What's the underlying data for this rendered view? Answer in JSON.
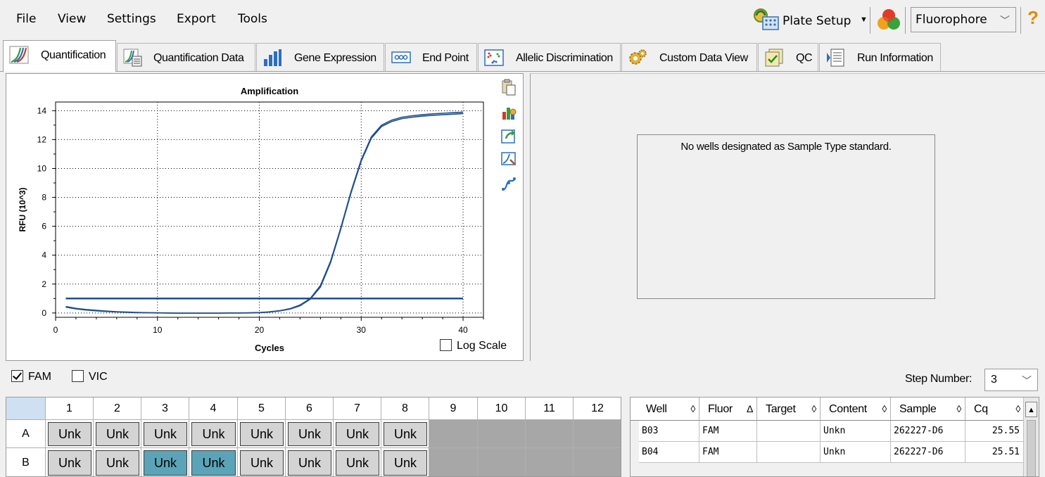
{
  "menu": [
    "File",
    "View",
    "Settings",
    "Export",
    "Tools"
  ],
  "toolbar": {
    "plate_setup_label": "Plate Setup",
    "fluorophore_select": "Fluorophore",
    "help": "?"
  },
  "tabs": [
    {
      "label": "Quantification",
      "icon": "amplification-tab-icon",
      "active": true
    },
    {
      "label": "Quantification Data",
      "icon": "quant-data-tab-icon",
      "active": false
    },
    {
      "label": "Gene Expression",
      "icon": "bar-chart-icon",
      "active": false
    },
    {
      "label": "End Point",
      "icon": "dots-icon",
      "active": false
    },
    {
      "label": "Allelic Discrimination",
      "icon": "scatter-icon",
      "active": false
    },
    {
      "label": "Custom Data View",
      "icon": "gears-icon",
      "active": false
    },
    {
      "label": "QC",
      "icon": "qc-check-icon",
      "active": false
    },
    {
      "label": "Run Information",
      "icon": "document-icon",
      "active": false
    }
  ],
  "chart_tools": [
    "copy-icon",
    "chart-settings-icon",
    "export-chart-icon",
    "zoom-chart-icon",
    "curve-icon"
  ],
  "log_scale_label": "Log Scale",
  "chart_data": {
    "type": "line",
    "title": "Amplification",
    "xlabel": "Cycles",
    "ylabel": "RFU (10^3)",
    "xlim": [
      0,
      42
    ],
    "ylim": [
      -0.3,
      14.6
    ],
    "xticks": [
      0,
      10,
      20,
      30,
      40
    ],
    "yticks": [
      0,
      2,
      4,
      6,
      8,
      10,
      12,
      14
    ],
    "grid": true,
    "log_scale": false,
    "colors": {
      "curve": "#1f4e8c",
      "threshold": "#1f4e8c"
    },
    "series": [
      {
        "x": [
          1,
          2,
          3,
          4,
          5,
          6,
          7,
          8,
          9,
          10,
          11,
          12,
          13,
          14,
          15,
          16,
          17,
          18,
          19,
          20,
          21,
          22,
          23,
          24,
          25,
          26,
          27,
          28,
          29,
          30,
          31,
          32,
          33,
          34,
          35,
          36,
          37,
          38,
          39,
          40
        ],
        "values": [
          0.45,
          0.32,
          0.24,
          0.18,
          0.13,
          0.09,
          0.06,
          0.04,
          0.02,
          0.01,
          0.0,
          -0.01,
          -0.01,
          -0.01,
          -0.01,
          -0.01,
          0.0,
          0.0,
          0.01,
          0.03,
          0.08,
          0.16,
          0.3,
          0.55,
          1.0,
          1.9,
          3.6,
          5.9,
          8.4,
          10.6,
          12.2,
          13.0,
          13.35,
          13.55,
          13.65,
          13.72,
          13.78,
          13.82,
          13.86,
          13.9
        ]
      },
      {
        "x": [
          1,
          2,
          3,
          4,
          5,
          6,
          7,
          8,
          9,
          10,
          11,
          12,
          13,
          14,
          15,
          16,
          17,
          18,
          19,
          20,
          21,
          22,
          23,
          24,
          25,
          26,
          27,
          28,
          29,
          30,
          31,
          32,
          33,
          34,
          35,
          36,
          37,
          38,
          39,
          40
        ],
        "values": [
          0.4,
          0.28,
          0.2,
          0.15,
          0.1,
          0.07,
          0.04,
          0.02,
          0.01,
          0.0,
          -0.01,
          -0.02,
          -0.02,
          -0.02,
          -0.02,
          -0.02,
          -0.01,
          -0.01,
          0.0,
          0.02,
          0.06,
          0.14,
          0.27,
          0.5,
          0.95,
          1.8,
          3.5,
          5.8,
          8.3,
          10.5,
          12.1,
          12.9,
          13.25,
          13.45,
          13.55,
          13.62,
          13.68,
          13.72,
          13.76,
          13.8
        ]
      }
    ],
    "threshold": {
      "value": 1.0,
      "x_range": [
        1,
        40
      ]
    }
  },
  "std_message": "No wells designated as Sample Type standard.",
  "filters": [
    {
      "label": "FAM",
      "checked": true
    },
    {
      "label": "VIC",
      "checked": false
    }
  ],
  "step": {
    "label": "Step Number:",
    "value": "3"
  },
  "plate": {
    "columns": [
      "1",
      "2",
      "3",
      "4",
      "5",
      "6",
      "7",
      "8",
      "9",
      "10",
      "11",
      "12"
    ],
    "rows": [
      {
        "label": "A",
        "wells": [
          "Unk",
          "Unk",
          "Unk",
          "Unk",
          "Unk",
          "Unk",
          "Unk",
          "Unk",
          "",
          "",
          "",
          ""
        ],
        "selected": [
          false,
          false,
          false,
          false,
          false,
          false,
          false,
          false,
          false,
          false,
          false,
          false
        ]
      },
      {
        "label": "B",
        "wells": [
          "Unk",
          "Unk",
          "Unk",
          "Unk",
          "Unk",
          "Unk",
          "Unk",
          "Unk",
          "",
          "",
          "",
          ""
        ],
        "selected": [
          false,
          false,
          true,
          true,
          false,
          false,
          false,
          false,
          false,
          false,
          false,
          false
        ]
      }
    ]
  },
  "results": {
    "headers": [
      {
        "label": "Well",
        "sort": "◊"
      },
      {
        "label": "Fluor",
        "sort": "Δ"
      },
      {
        "label": "Target",
        "sort": "◊"
      },
      {
        "label": "Content",
        "sort": "◊"
      },
      {
        "label": "Sample",
        "sort": "◊"
      },
      {
        "label": "Cq",
        "sort": "◊"
      }
    ],
    "rows": [
      [
        "B03",
        "FAM",
        "",
        "Unkn",
        "262227-D6",
        "25.55"
      ],
      [
        "B04",
        "FAM",
        "",
        "Unkn",
        "262227-D6",
        "25.51"
      ]
    ]
  }
}
